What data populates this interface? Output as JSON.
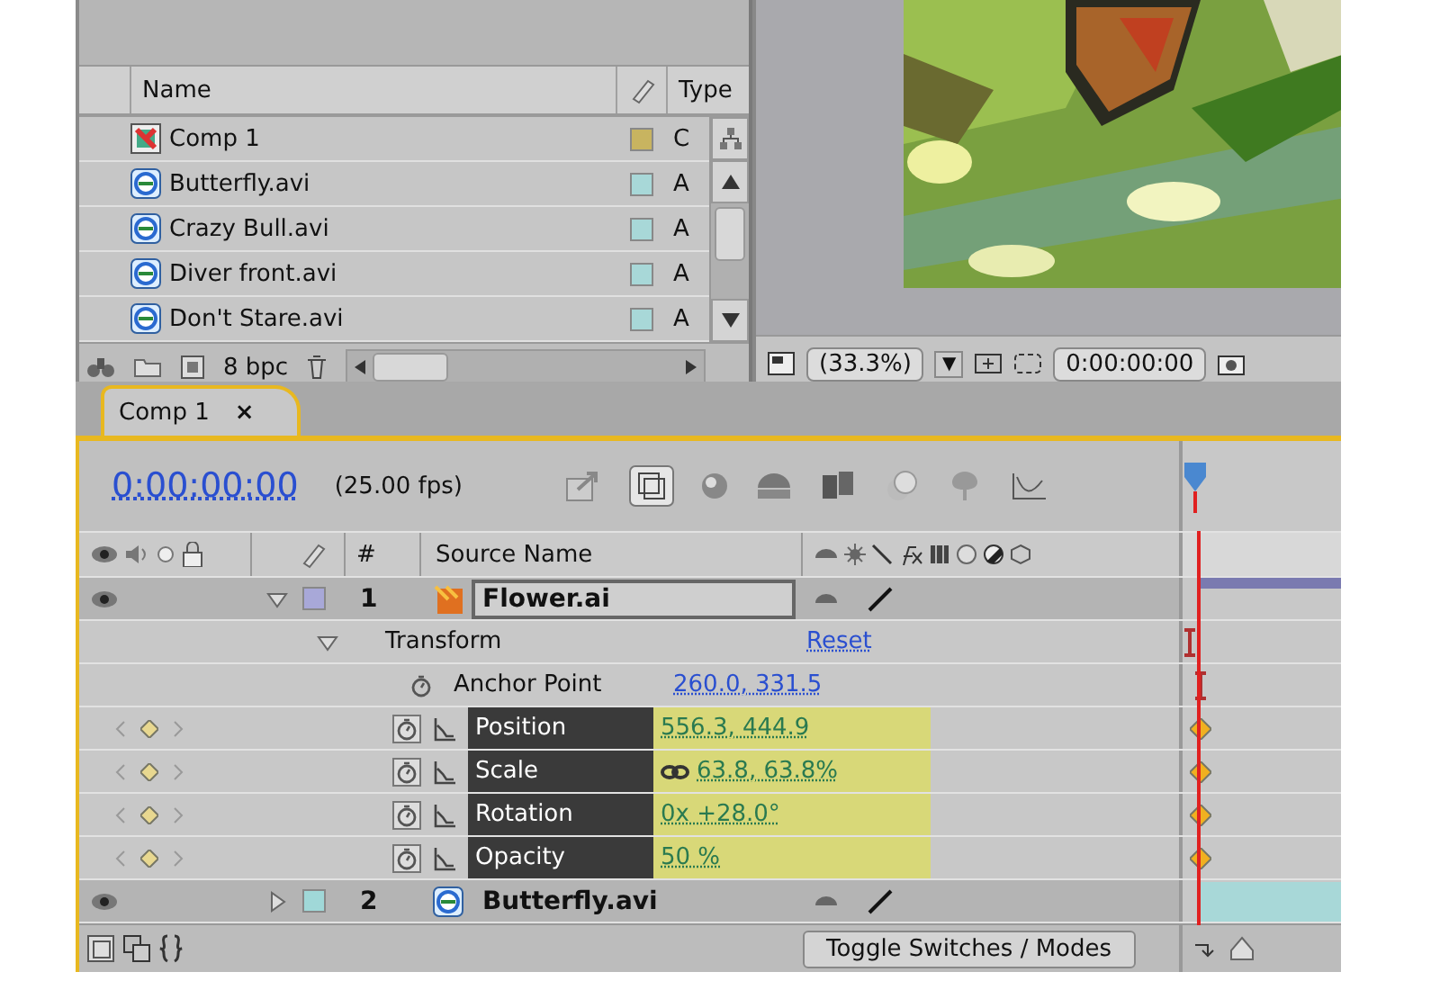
{
  "project": {
    "columns": {
      "name": "Name",
      "type": "Type"
    },
    "items": [
      {
        "name": "Comp 1",
        "type": "C",
        "kind": "comp",
        "color": "#c8b460"
      },
      {
        "name": "Butterfly.avi",
        "type": "A",
        "kind": "video",
        "color": "#a8d8d8"
      },
      {
        "name": "Crazy Bull.avi",
        "type": "A",
        "kind": "video",
        "color": "#a8d8d8"
      },
      {
        "name": "Diver front.avi",
        "type": "A",
        "kind": "video",
        "color": "#a8d8d8"
      },
      {
        "name": "Don't Stare.avi",
        "type": "A",
        "kind": "video",
        "color": "#a8d8d8"
      }
    ],
    "footer": {
      "depth": "8 bpc"
    }
  },
  "viewer": {
    "magnification": "(33.3%)",
    "dropdown": "▼",
    "timecode": "0:00:00:00"
  },
  "timeline": {
    "tab": {
      "label": "Comp 1",
      "close": "×",
      "selected": true
    },
    "time": "0:00:00:00",
    "fps": "(25.00 fps)",
    "columns": {
      "number": "#",
      "source": "Source Name"
    },
    "rows": [
      {
        "kind": "layer",
        "number": "1",
        "name": "Flower.ai",
        "icon": {
          "kind": "illustrator"
        },
        "color": "#a8a8d8",
        "expanded": true,
        "selected": true
      },
      {
        "kind": "group",
        "name": "Transform",
        "expanded": true,
        "value": "Reset"
      },
      {
        "kind": "property",
        "name": "Anchor Point",
        "value": "260.0, 331.5",
        "animated": false,
        "selected": false,
        "linked": false
      },
      {
        "kind": "property",
        "name": "Position",
        "value": "556.3, 444.9",
        "animated": true,
        "selected": true,
        "linked": false
      },
      {
        "kind": "property",
        "name": "Scale",
        "value": "63.8, 63.8%",
        "animated": true,
        "selected": true,
        "linked": true
      },
      {
        "kind": "property",
        "name": "Rotation",
        "value": "0x +28.0°",
        "animated": true,
        "selected": true,
        "linked": false
      },
      {
        "kind": "property",
        "name": "Opacity",
        "value": "50 %",
        "animated": true,
        "selected": true,
        "linked": false
      },
      {
        "kind": "layer",
        "number": "2",
        "name": "Butterfly.avi",
        "icon": {
          "kind": "video"
        },
        "color": "#a0d8d8",
        "expanded": false,
        "selected": false
      }
    ],
    "toggle_button": "Toggle Switches / Modes"
  }
}
